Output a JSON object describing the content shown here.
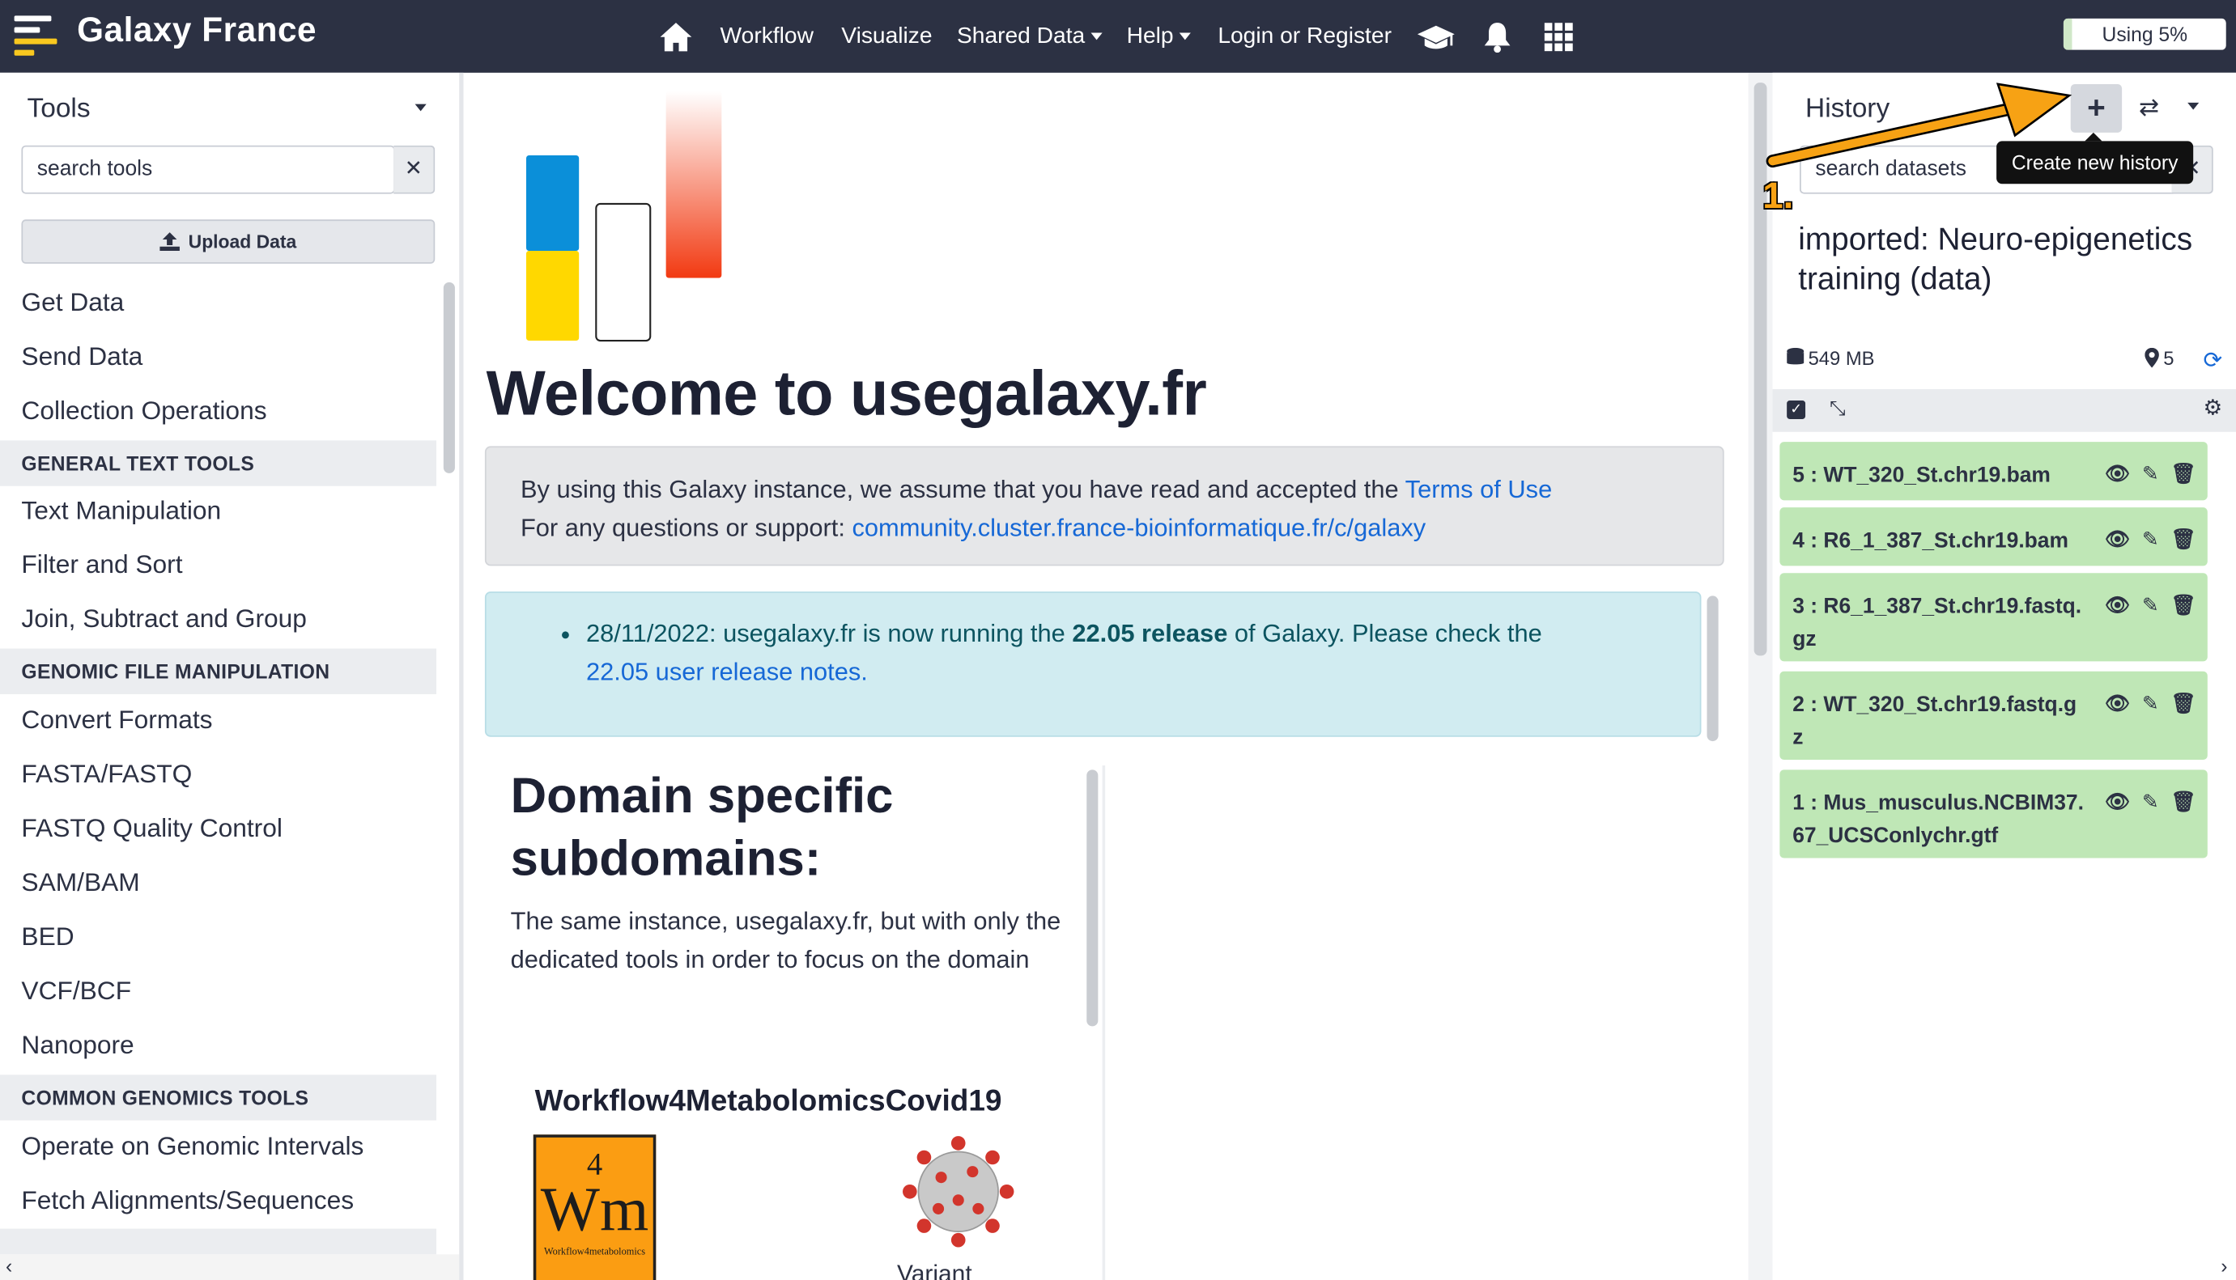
{
  "masthead": {
    "brand": "Galaxy France",
    "nav": [
      "Workflow",
      "Visualize",
      "Shared Data",
      "Help",
      "Login or Register"
    ],
    "quota_label": "Using 5%",
    "quota_fraction": 0.05,
    "icons": [
      "home-icon",
      "graduation-cap-icon",
      "bell-icon",
      "grid-icon"
    ]
  },
  "tools": {
    "title": "Tools",
    "search_placeholder": "search tools",
    "upload_label": "Upload Data",
    "items": [
      "Get Data",
      "Send Data",
      "Collection Operations"
    ],
    "section1": "GENERAL TEXT TOOLS",
    "items1": [
      "Text Manipulation",
      "Filter and Sort",
      "Join, Subtract and Group"
    ],
    "section2": "GENOMIC FILE MANIPULATION",
    "items2": [
      "Convert Formats",
      "FASTA/FASTQ",
      "FASTQ Quality Control",
      "SAM/BAM",
      "BED",
      "VCF/BCF",
      "Nanopore"
    ],
    "section3": "COMMON GENOMICS TOOLS",
    "items3": [
      "Operate on Genomic Intervals",
      "Fetch Alignments/Sequences"
    ]
  },
  "center": {
    "welcome": "Welcome to usegalaxy.fr",
    "info_line1": "By using this Galaxy instance, we assume that you have read and accepted the ",
    "terms_link": "Terms of Use",
    "info_line2": "For any questions or support: ",
    "support_link": "community.cluster.france-bioinformatique.fr/c/galaxy",
    "news_prefix": "28/11/2022: usegalaxy.fr is now running the ",
    "news_bold": "22.05 release",
    "news_suffix": " of Galaxy. Please check the ",
    "news_link": "22.05 user release notes.",
    "domain_heading": "Domain specific subdomains:",
    "domain_text": "The same instance, usegalaxy.fr, but with only the dedicated tools in order to focus on the domain",
    "w4m_title": "Workflow4MetabolomicsCovid19",
    "w4m_logo_num": "4",
    "w4m_logo_text": "Wm",
    "w4m_logo_sub": "Workflow4metabolomics",
    "variant": "Variant"
  },
  "history": {
    "title": "History",
    "tooltip": "Create new history",
    "search_placeholder": "search datasets",
    "name": "imported: Neuro-epigenetics training (data)",
    "size": "549 MB",
    "count": "5",
    "datasets": [
      {
        "id": "5",
        "name": "WT_320_St.chr19.bam"
      },
      {
        "id": "4",
        "name": "R6_1_387_St.chr19.bam"
      },
      {
        "id": "3",
        "name": "R6_1_387_St.chr19.fastq.gz"
      },
      {
        "id": "2",
        "name": "WT_320_St.chr19.fastq.gz"
      },
      {
        "id": "1",
        "name": "Mus_musculus.NCBIM37.67_UCSConlychr.gtf"
      }
    ]
  },
  "annotation": {
    "step": "1."
  },
  "colors": {
    "masthead": "#2c3143",
    "dataset_ok": "#bfe7b6",
    "link": "#1668d6",
    "info_bg": "#d1ecf1",
    "arrow": "#f7a214"
  }
}
